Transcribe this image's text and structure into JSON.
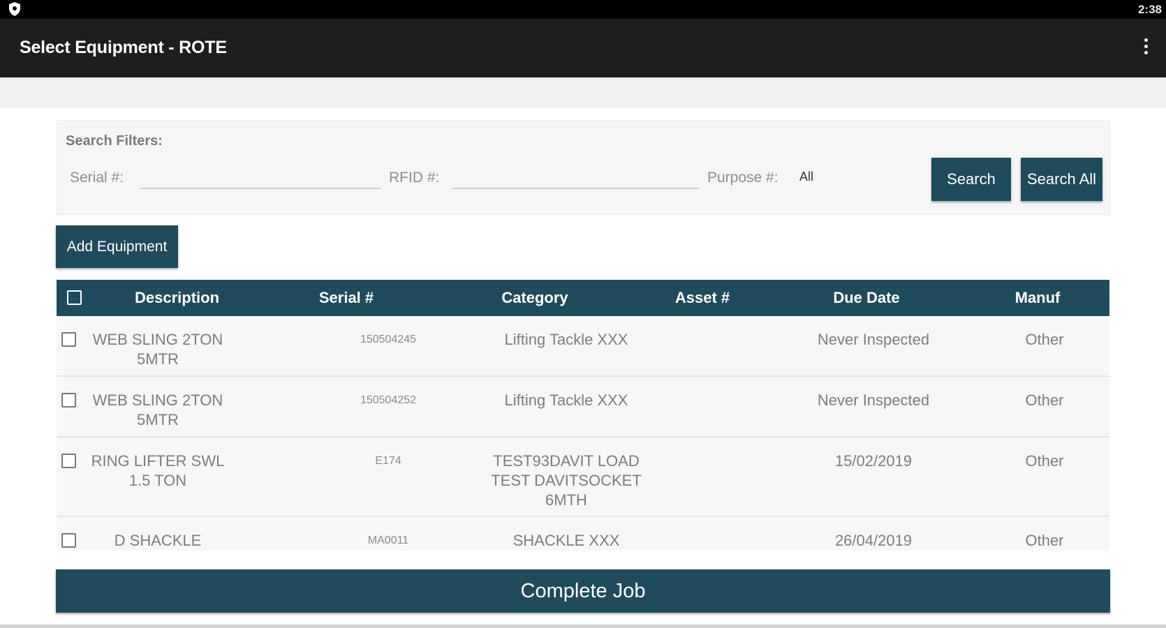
{
  "status_bar": {
    "time": "2:38"
  },
  "app_bar": {
    "title": "Select Equipment - ROTE",
    "menu_icon": "overflow-menu-icon"
  },
  "filters": {
    "title": "Search Filters:",
    "serial_label": "Serial #:",
    "serial_value": "",
    "rfid_label": "RFID #:",
    "rfid_value": "",
    "purpose_label": "Purpose #:",
    "purpose_value": "All",
    "search_label": "Search",
    "search_all_label": "Search All"
  },
  "add_equipment_label": "Add Equipment",
  "table": {
    "headers": {
      "description": "Description",
      "serial": "Serial #",
      "category": "Category",
      "asset": "Asset #",
      "due_date": "Due Date",
      "manuf": "Manuf"
    },
    "rows": [
      {
        "description": "WEB SLING 2TON 5MTR",
        "serial": "150504245",
        "category": "Lifting Tackle XXX",
        "asset": "",
        "due_date": "Never Inspected",
        "manuf": "Other",
        "checked": false
      },
      {
        "description": "WEB SLING 2TON 5MTR",
        "serial": "150504252",
        "category": "Lifting Tackle XXX",
        "asset": "",
        "due_date": "Never Inspected",
        "manuf": "Other",
        "checked": false
      },
      {
        "description": "RING LIFTER  SWL 1.5 TON",
        "serial": "E174",
        "category": "TEST93DAVIT  LOAD TEST DAVITSOCKET 6MTH",
        "asset": "",
        "due_date": "15/02/2019",
        "manuf": "Other",
        "checked": false
      },
      {
        "description": "D SHACKLE",
        "serial": "MA0011",
        "category": "SHACKLE XXX",
        "asset": "",
        "due_date": "26/04/2019",
        "manuf": "Other",
        "checked": false
      }
    ]
  },
  "complete_job_label": "Complete Job",
  "colors": {
    "primary": "#1f4b5c",
    "app_bar": "#1e1e1e",
    "status_bar": "#000000"
  }
}
